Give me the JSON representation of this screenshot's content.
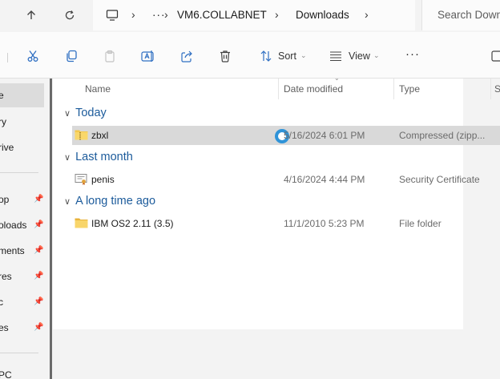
{
  "address_bar": {
    "crumbs": [
      "VM6.COLLABNET",
      "Downloads"
    ],
    "search_placeholder": "Search Downloads"
  },
  "toolbar": {
    "sort_label": "Sort",
    "view_label": "View",
    "more_label": "···"
  },
  "sidebar": {
    "items": [
      {
        "label": "e",
        "selected": true
      },
      {
        "label": "ry"
      },
      {
        "label": "rive"
      },
      {
        "label": "op",
        "pinned": true
      },
      {
        "label": "oloads",
        "pinned": true
      },
      {
        "label": "ments",
        "pinned": true
      },
      {
        "label": "res",
        "pinned": true
      },
      {
        "label": "c",
        "pinned": true
      },
      {
        "label": "es",
        "pinned": true
      },
      {
        "label": "PC"
      }
    ]
  },
  "columns": {
    "name": "Name",
    "date_modified": "Date modified",
    "type": "Type",
    "size": "S"
  },
  "groups": [
    {
      "label": "Today",
      "files": [
        {
          "name": "zbxl",
          "date": "5/16/2024 6:01 PM",
          "type": "Compressed (zipp...",
          "icon": "zip-folder-icon",
          "selected": true
        }
      ]
    },
    {
      "label": "Last month",
      "files": [
        {
          "name": "penis",
          "date": "4/16/2024 4:44 PM",
          "type": "Security Certificate",
          "icon": "certificate-icon"
        }
      ]
    },
    {
      "label": "A long time ago",
      "files": [
        {
          "name": "IBM OS2 2.11 (3.5)",
          "date": "11/1/2010 5:23 PM",
          "type": "File folder",
          "icon": "folder-icon"
        }
      ]
    }
  ],
  "colors": {
    "accent": "#1c5b9b",
    "busy": "#2f93d8",
    "selection": "#d9d9d9"
  }
}
